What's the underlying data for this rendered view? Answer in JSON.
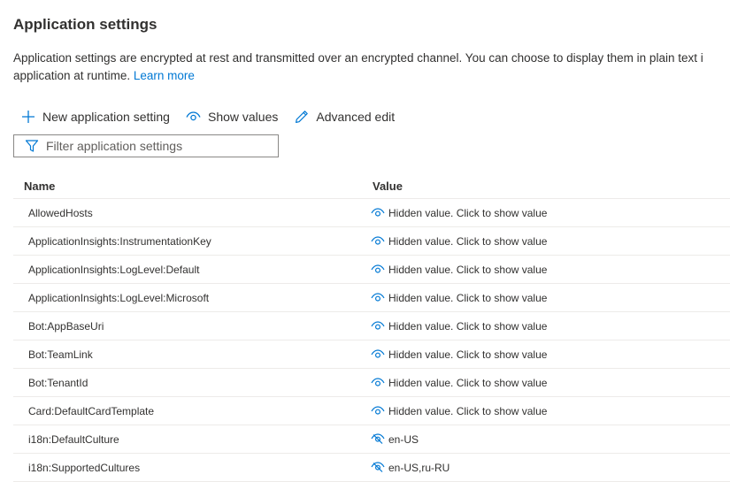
{
  "page": {
    "title": "Application settings",
    "description_line1": "Application settings are encrypted at rest and transmitted over an encrypted channel. You can choose to display them in plain text i",
    "description_line2": "application at runtime. ",
    "learn_more": "Learn more"
  },
  "toolbar": {
    "new_setting_label": "New application setting",
    "new_setting_icon": "plus-icon",
    "show_values_label": "Show values",
    "show_values_icon": "eye-icon",
    "advanced_edit_label": "Advanced edit",
    "advanced_edit_icon": "pencil-icon"
  },
  "filter": {
    "placeholder": "Filter application settings",
    "value": "",
    "icon": "filter-icon"
  },
  "grid": {
    "columns": {
      "name": "Name",
      "value": "Value"
    },
    "rows": [
      {
        "name": "AllowedHosts",
        "value": "Hidden value. Click to show value",
        "icon": "eye-icon"
      },
      {
        "name": "ApplicationInsights:InstrumentationKey",
        "value": "Hidden value. Click to show value",
        "icon": "eye-icon"
      },
      {
        "name": "ApplicationInsights:LogLevel:Default",
        "value": "Hidden value. Click to show value",
        "icon": "eye-icon"
      },
      {
        "name": "ApplicationInsights:LogLevel:Microsoft",
        "value": "Hidden value. Click to show value",
        "icon": "eye-icon"
      },
      {
        "name": "Bot:AppBaseUri",
        "value": "Hidden value. Click to show value",
        "icon": "eye-icon"
      },
      {
        "name": "Bot:TeamLink",
        "value": "Hidden value. Click to show value",
        "icon": "eye-icon"
      },
      {
        "name": "Bot:TenantId",
        "value": "Hidden value. Click to show value",
        "icon": "eye-icon"
      },
      {
        "name": "Card:DefaultCardTemplate",
        "value": "Hidden value. Click to show value",
        "icon": "eye-icon"
      },
      {
        "name": "i18n:DefaultCulture",
        "value": "en-US",
        "icon": "eye-slash-icon"
      },
      {
        "name": "i18n:SupportedCultures",
        "value": "en-US,ru-RU",
        "icon": "eye-slash-icon"
      }
    ]
  },
  "colors": {
    "accent": "#0078d4",
    "text": "#323130",
    "border": "#8a8886",
    "divider": "#edebe9"
  }
}
